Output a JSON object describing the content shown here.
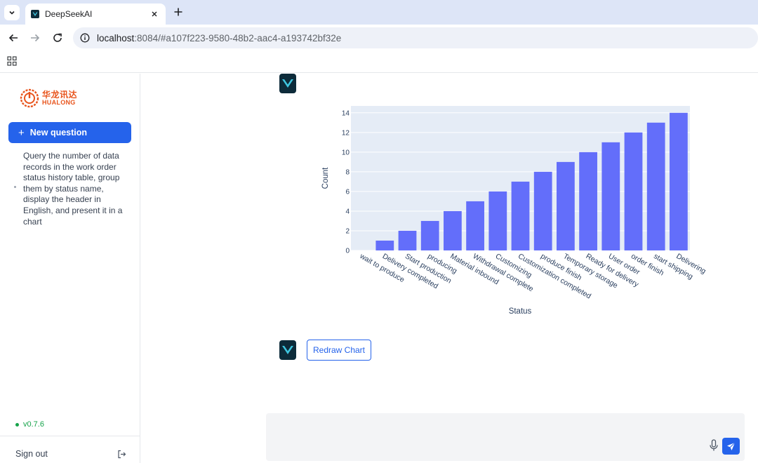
{
  "browser": {
    "tab_title": "DeepSeekAI",
    "url_host": "localhost",
    "url_rest": ":8084/#a107f223-9580-48b2-aac4-a193742bf32e"
  },
  "sidebar": {
    "logo_cn": "华龙讯达",
    "logo_en": "HUALONG",
    "new_question_label": "New question",
    "history": [
      {
        "text": "Query the number of data records in the work order status history table, group them by status name, display the header in English, and present it in a chart"
      }
    ],
    "version": "v0.7.6",
    "signout_label": "Sign out"
  },
  "main": {
    "redraw_label": "Redraw Chart",
    "input_value": ""
  },
  "colors": {
    "accent": "#2563eb",
    "bar": "#636efa",
    "plot_bg": "#e5ecf6",
    "logo": "#e8541c",
    "version": "#16a34a"
  },
  "icons": [
    "chevron-down-icon",
    "close-icon",
    "plus-icon",
    "back-arrow-icon",
    "forward-arrow-icon",
    "reload-icon",
    "info-icon",
    "apps-grid-icon",
    "deepseek-avatar-icon",
    "logout-icon",
    "mic-icon",
    "send-icon"
  ],
  "chart_data": {
    "type": "bar",
    "xlabel": "Status",
    "ylabel": "Count",
    "ylim": [
      0,
      14.7
    ],
    "yticks": [
      0,
      2,
      4,
      6,
      8,
      10,
      12,
      14
    ],
    "grid": true,
    "categories": [
      "wait to produce",
      "Delivery completed",
      "Start production",
      "producing",
      "Material inbound",
      "Withdrawal complete",
      "Customizing",
      "Customization completed",
      "produce finish",
      "Temporary storage",
      "Ready for delivery",
      "User order",
      "order finish",
      "start shipping",
      "Delivering"
    ],
    "values": [
      0,
      1,
      2,
      3,
      4,
      5,
      6,
      7,
      8,
      9,
      10,
      11,
      12,
      13,
      14
    ]
  }
}
